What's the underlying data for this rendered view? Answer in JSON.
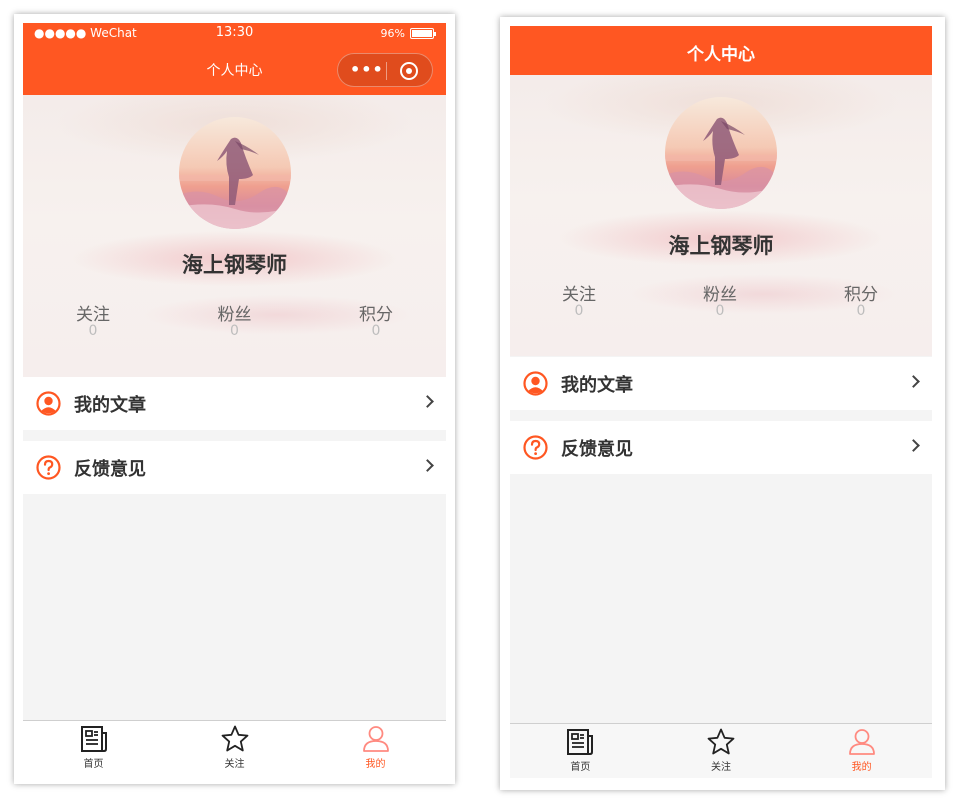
{
  "status_bar": {
    "carrier": "●●●●● WeChat",
    "time": "13:30",
    "battery": "96%",
    "battery_level": 0.96
  },
  "nav": {
    "title": "个人中心",
    "menu_dots": "•••"
  },
  "profile": {
    "username": "海上钢琴师",
    "stats": [
      {
        "label": "关注",
        "value": "0"
      },
      {
        "label": "粉丝",
        "value": "0"
      },
      {
        "label": "积分",
        "value": "0"
      }
    ]
  },
  "menu": [
    {
      "label": "我的文章",
      "icon": "user-circle-icon"
    },
    {
      "label": "反馈意见",
      "icon": "question-circle-icon"
    }
  ],
  "tabs": [
    {
      "label": "首页",
      "icon": "newspaper-icon",
      "active": false
    },
    {
      "label": "关注",
      "icon": "star-icon",
      "active": false
    },
    {
      "label": "我的",
      "icon": "user-icon",
      "active": true
    }
  ],
  "colors": {
    "accent": "#ff5722",
    "background": "#f4f4f4",
    "text": "#333333",
    "muted": "#bdbdbd"
  }
}
